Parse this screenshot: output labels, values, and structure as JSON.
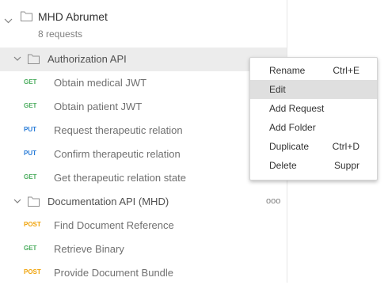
{
  "collection": {
    "name": "MHD Abrumet",
    "count": "8 requests"
  },
  "folders": [
    {
      "name": "Authorization API",
      "selected": true,
      "requests": [
        {
          "method": "GET",
          "name": "Obtain medical JWT"
        },
        {
          "method": "GET",
          "name": "Obtain patient JWT"
        },
        {
          "method": "PUT",
          "name": "Request therapeutic relation"
        },
        {
          "method": "PUT",
          "name": "Confirm therapeutic relation"
        },
        {
          "method": "GET",
          "name": "Get therapeutic relation state"
        }
      ]
    },
    {
      "name": "Documentation API (MHD)",
      "selected": false,
      "more_icon": "ooo",
      "requests": [
        {
          "method": "POST",
          "name": "Find Document Reference"
        },
        {
          "method": "GET",
          "name": "Retrieve Binary"
        },
        {
          "method": "POST",
          "name": "Provide Document Bundle"
        }
      ]
    }
  ],
  "context_menu": {
    "items": [
      {
        "label": "Rename",
        "shortcut": "Ctrl+E"
      },
      {
        "label": "Edit",
        "shortcut": "",
        "hovered": true
      },
      {
        "label": "Add Request",
        "shortcut": ""
      },
      {
        "label": "Add Folder",
        "shortcut": ""
      },
      {
        "label": "Duplicate",
        "shortcut": "Ctrl+D"
      },
      {
        "label": "Delete",
        "shortcut": "Suppr"
      }
    ]
  },
  "colors": {
    "get": "#4cad5f",
    "put": "#2a7dd8",
    "post": "#f0a30a",
    "selected_row": "#ececec",
    "menu_hover": "#dfdfdf"
  },
  "icons": {
    "chevron": "chevron-down-icon",
    "folder": "folder-icon",
    "more": "more-options-icon"
  }
}
